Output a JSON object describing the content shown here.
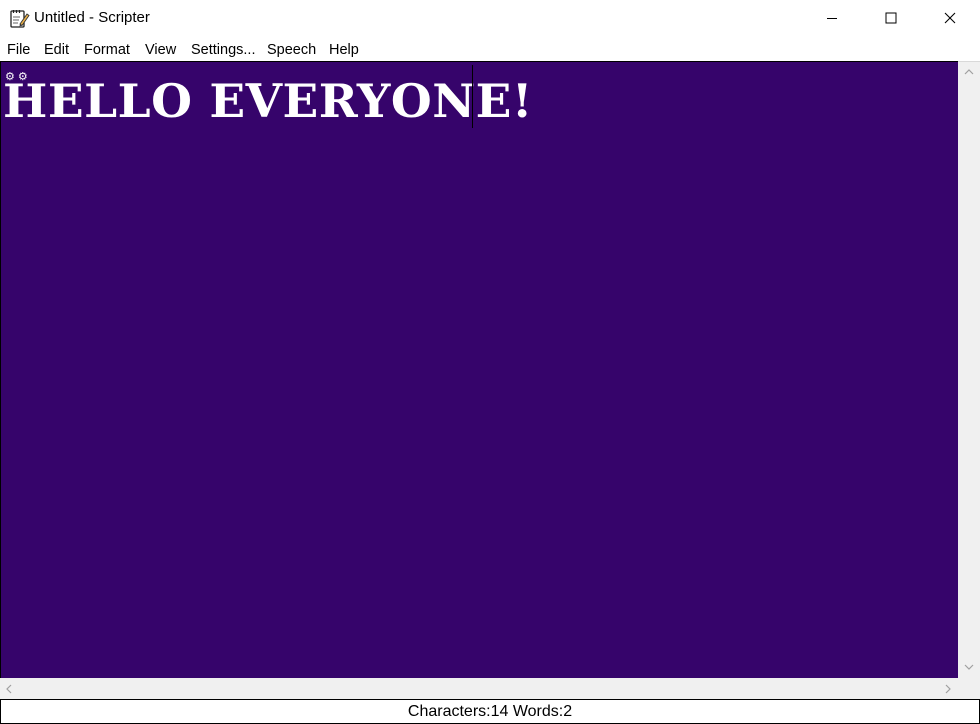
{
  "window": {
    "title": "Untitled - Scripter",
    "app_icon": "notepad-pencil-icon",
    "controls": [
      "minimize-icon",
      "maximize-icon",
      "close-icon"
    ]
  },
  "menu": {
    "items": [
      "File",
      "Edit",
      "Format",
      "View",
      "Settings...",
      "Speech",
      "Help"
    ]
  },
  "editor": {
    "text": "HELLO EVERYONE!",
    "background_color": "#36046b",
    "text_color": "#ffffff",
    "corner_glyphs": "⚙ ⚙"
  },
  "status": {
    "text": "Characters:14 Words:2"
  }
}
